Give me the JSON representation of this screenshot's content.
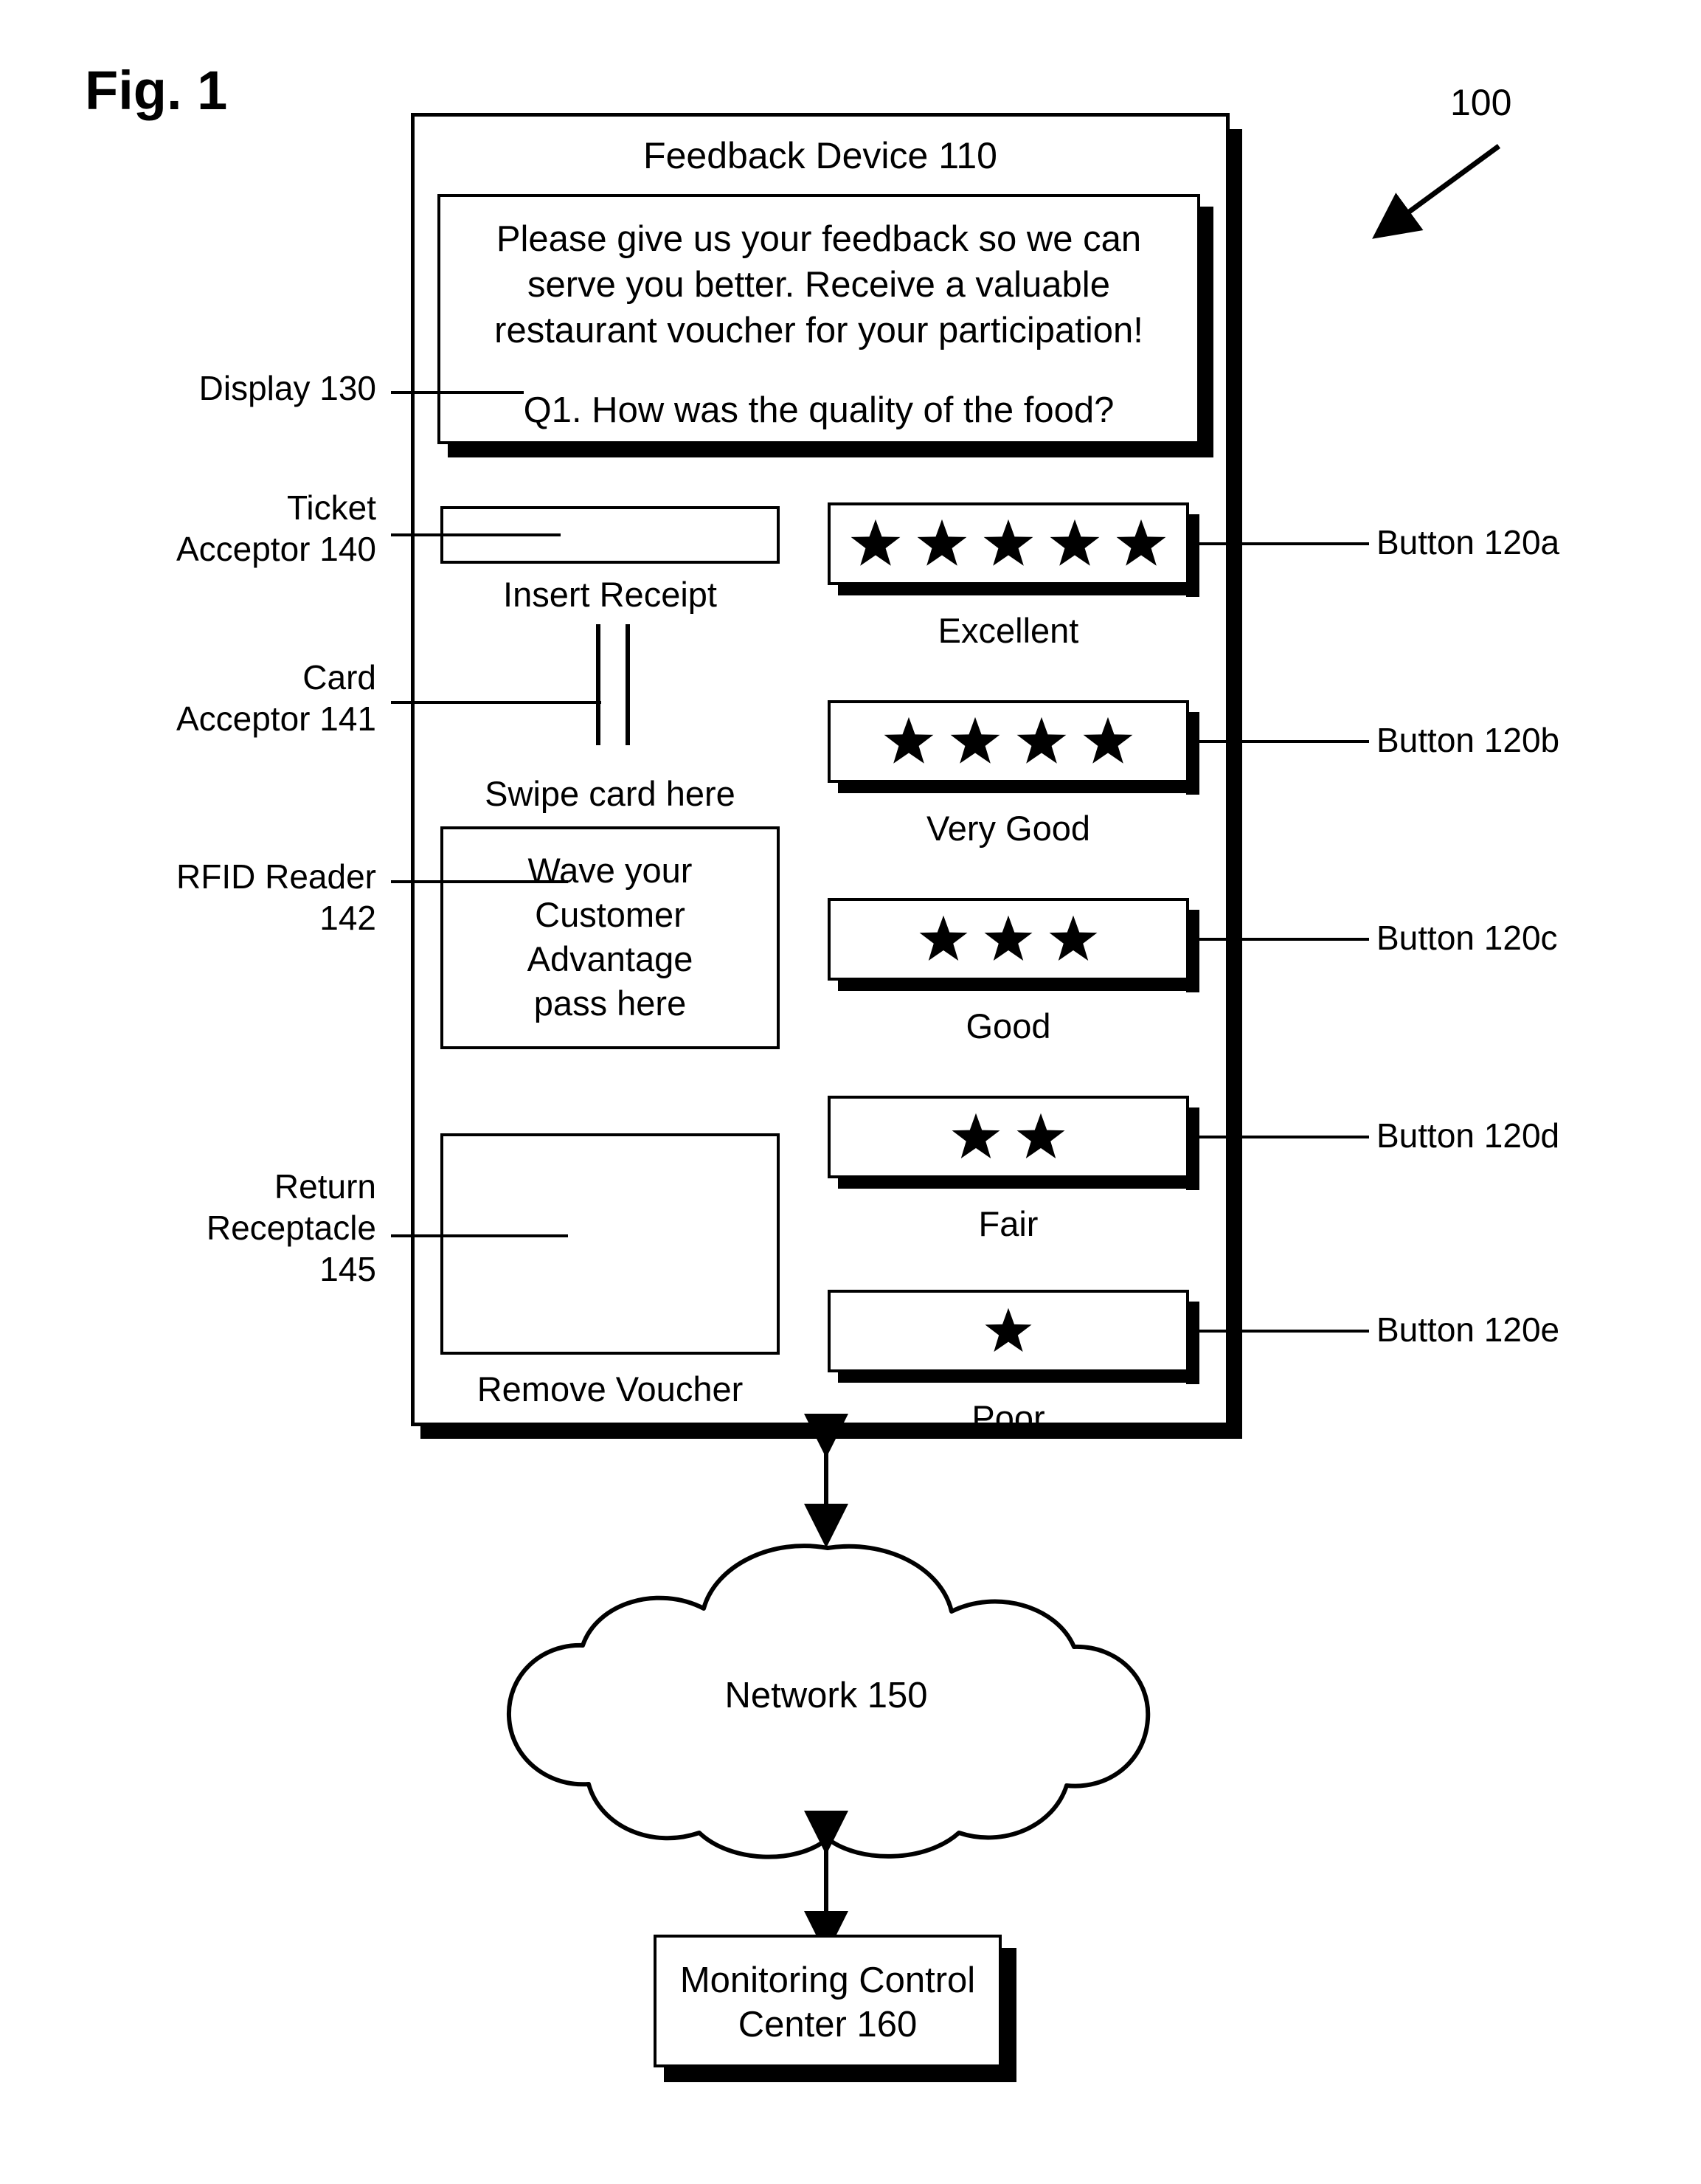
{
  "figure": {
    "title": "Fig. 1",
    "system_numeral": "100"
  },
  "device": {
    "title": "Feedback Device 110",
    "display": {
      "label": "Display 130",
      "lines": [
        "Please give us your feedback so we can",
        "serve you better. Receive a valuable",
        "restaurant voucher for your participation!",
        "",
        "Q1. How was the quality of the food?"
      ],
      "intro": "Please give us your feedback so we can serve you better. Receive a valuable restaurant voucher for your participation!",
      "question": "Q1. How was the quality of the food?"
    },
    "ticket_acceptor": {
      "label": "Ticket\nAcceptor 140",
      "caption": "Insert Receipt"
    },
    "card_acceptor": {
      "label": "Card\nAcceptor 141",
      "caption": "Swipe card here"
    },
    "rfid_reader": {
      "label": "RFID Reader\n142",
      "text": "Wave your\nCustomer\nAdvantage\npass here"
    },
    "return_receptacle": {
      "label": "Return\nReceptacle\n145",
      "caption": "Remove Voucher"
    },
    "buttons": [
      {
        "stars": 5,
        "caption": "Excellent",
        "ref": "Button 120a"
      },
      {
        "stars": 4,
        "caption": "Very Good",
        "ref": "Button 120b"
      },
      {
        "stars": 3,
        "caption": "Good",
        "ref": "Button 120c"
      },
      {
        "stars": 2,
        "caption": "Fair",
        "ref": "Button 120d"
      },
      {
        "stars": 1,
        "caption": "Poor",
        "ref": "Button 120e"
      }
    ]
  },
  "network": {
    "label": "Network 150"
  },
  "monitoring_center": {
    "label": "Monitoring Control\nCenter 160"
  },
  "colors": {
    "ink": "#000000",
    "paper": "#ffffff"
  }
}
